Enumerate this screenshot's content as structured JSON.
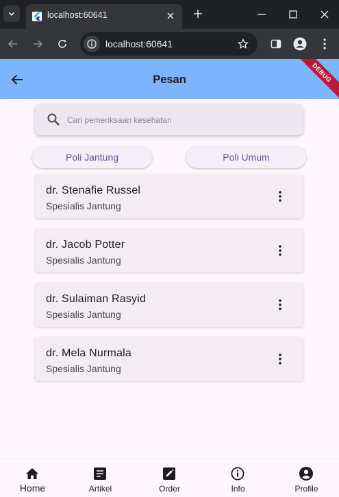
{
  "browser": {
    "tab_title": "localhost:60641",
    "url": "localhost:60641"
  },
  "appbar": {
    "title": "Pesan",
    "debug_banner": "DEBUG"
  },
  "search": {
    "placeholder": "Cari pemeriksaan kesehatan"
  },
  "filters": [
    {
      "label": "Poli Jantung"
    },
    {
      "label": "Poli Umum"
    }
  ],
  "doctors": [
    {
      "name": "dr. Stenafie Russel",
      "specialty": "Spesialis Jantung"
    },
    {
      "name": "dr. Jacob Potter",
      "specialty": "Spesialis Jantung"
    },
    {
      "name": "dr. Sulaiman Rasyid",
      "specialty": "Spesialis Jantung"
    },
    {
      "name": "dr. Mela Nurmala",
      "specialty": "Spesialis Jantung"
    }
  ],
  "bottom_nav": [
    {
      "label": "Home",
      "icon": "home-icon"
    },
    {
      "label": "Artikel",
      "icon": "article-icon"
    },
    {
      "label": "Order",
      "icon": "edit-note-icon"
    },
    {
      "label": "Info",
      "icon": "info-icon"
    },
    {
      "label": "Profile",
      "icon": "account-circle-icon"
    }
  ],
  "colors": {
    "appbar": "#7db5fd",
    "chip_text": "#6750a4",
    "debug_banner": "#b71c3a"
  }
}
